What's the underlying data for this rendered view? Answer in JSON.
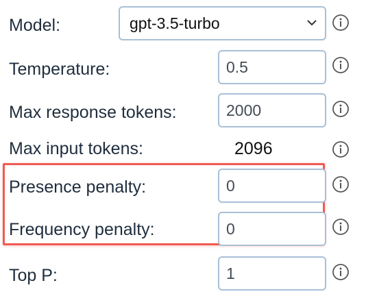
{
  "model": {
    "label": "Model:",
    "selected": "gpt-3.5-turbo"
  },
  "temperature": {
    "label": "Temperature:",
    "value": "0.5"
  },
  "max_response_tokens": {
    "label": "Max response tokens:",
    "value": "2000"
  },
  "max_input_tokens": {
    "label": "Max input tokens:",
    "value": "2096"
  },
  "presence_penalty": {
    "label": "Presence penalty:",
    "value": "0"
  },
  "frequency_penalty": {
    "label": "Frequency penalty:",
    "value": "0"
  },
  "top_p": {
    "label": "Top P:",
    "value": "1"
  },
  "icons": {
    "info": "info-circle-icon",
    "dropdown": "chevron-down-icon"
  },
  "colors": {
    "highlight": "#ee5b52",
    "field_border": "#a8bfd6"
  }
}
